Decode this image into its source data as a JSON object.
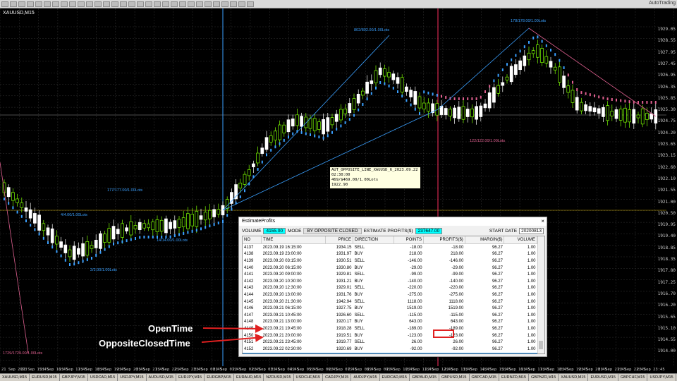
{
  "app": {
    "brand": "AutoTrading",
    "symbol": "XAUUSD,M15"
  },
  "colors": {
    "up": "#7cfc00",
    "down": "#ffffff",
    "dotUp": "#3aa0ff",
    "dotDown": "#e06090",
    "grid": "#333333",
    "cursor": "#3aa0ff",
    "marker": "#ff3060"
  },
  "price_axis": [
    "1929.05",
    "1928.55",
    "1927.95",
    "1927.45",
    "1926.95",
    "1926.35",
    "1925.85",
    "1925.30",
    "1924.75",
    "1924.20",
    "1923.65",
    "1923.15",
    "1922.60",
    "1922.10",
    "1921.55",
    "1921.00",
    "1920.50",
    "1919.95",
    "1919.40",
    "1918.85",
    "1918.35",
    "1917.80",
    "1917.25",
    "1916.70",
    "1916.20",
    "1915.65",
    "1915.10",
    "1914.55",
    "1914.00"
  ],
  "time_axis": [
    "21 Sep 2023",
    "21 Sep 15:45",
    "21 Sep 16:45",
    "21 Sep 17:45",
    "21 Sep 18:45",
    "21 Sep 19:45",
    "21 Sep 20:45",
    "21 Sep 21:45",
    "21 Sep 22:45",
    "21 Sep 23:45",
    "22 Sep 00:45",
    "22 Sep 01:45",
    "22 Sep 02:45",
    "22 Sep 03:45",
    "22 Sep 04:45",
    "22 Sep 05:45",
    "22 Sep 06:45",
    "22 Sep 07:45",
    "22 Sep 08:45",
    "22 Sep 09:45",
    "22 Sep 10:45",
    "22 Sep 11:45",
    "22 Sep 12:45",
    "22 Sep 13:45",
    "22 Sep 14:45",
    "22 Sep 15:45",
    "22 Sep 16:45",
    "22 Sep 17:45",
    "22 Sep 18:45",
    "22 Sep 19:45",
    "22 Sep 20:45",
    "22 Sep 21:45",
    "22 Sep 22:45",
    "22 Sep 23:45"
  ],
  "chart_notes": [
    "1729/1729.00/1.00Lots",
    "4/4.00/1.00Lots",
    "177/177.00/1.00Lots",
    "2/2.00/1.00Lots",
    "14/14.00/1.00Lots",
    "802/802.00/1.00Lots",
    "178/178.00/1.00Lots",
    "122/122.00/1.00Lots"
  ],
  "tooltip": [
    "AUT_OPPOSITE_LINE_XAUUSD_6_2023.09.22 02:30:00",
    "469/$469.00/1.00Lots",
    "1922.90"
  ],
  "tabs": [
    "XAUUSD,M15",
    "EURUSD,M15",
    "GBPJPY,M15",
    "USDCAD,M15",
    "USDJPY,M15",
    "AUDUSD,M15",
    "EURJPY,M15",
    "EURGBP,M15",
    "EURAUD,M15",
    "NZDUSD,M15",
    "USDCHF,M15",
    "CADJPY,M15",
    "AUDJPY,M15",
    "EURCAD,M15",
    "GBPAUD,M15",
    "GBPUSD,M15",
    "GBPCAD,M15",
    "EURNZD,M15",
    "GBPNZD,M15",
    "XAUUSD,M15",
    "EURUSD,M15",
    "GBPCHF,M15",
    "USDJPY,M15",
    "XAUUSD,Daily",
    "USDCHF,M15",
    "EURUSD,H1",
    "BTCUSD,M15",
    "XAUUSD,H1",
    "XAUUSD,H1",
    "XAUUSD,M15"
  ],
  "panel": {
    "title": "EstimateProfits",
    "volume_label": "VOLUME",
    "volume_value": "4155.00",
    "mode_label": "MODE",
    "mode_value": "BY OPPOSITE CLOSED",
    "estimate_label": "ESTIMATE PROFITS($)",
    "estimate_value": "237647.00",
    "start_date_label": "START DATE",
    "start_date_value": "20200813",
    "columns": [
      "NO",
      "TIME",
      "PRICE",
      "DIRECTION",
      "POINTS",
      "PROFITS($)",
      "MARGIN($)",
      "VOLUME"
    ],
    "rows": [
      [
        "4137",
        "2023.09.19 16:15:00",
        "1934.15",
        "SELL",
        "-18.00",
        "-18.00",
        "96.27",
        "1.00"
      ],
      [
        "4138",
        "2023.09.19 23:00:00",
        "1931.97",
        "BUY",
        "218.00",
        "218.00",
        "96.27",
        "1.00"
      ],
      [
        "4139",
        "2023.09.20 03:15:00",
        "1930.51",
        "SELL",
        "-146.00",
        "-146.00",
        "96.27",
        "1.00"
      ],
      [
        "4140",
        "2023.09.20 06:15:00",
        "1930.80",
        "BUY",
        "-29.00",
        "-29.00",
        "96.27",
        "1.00"
      ],
      [
        "4141",
        "2023.09.20 09:00:00",
        "1929.81",
        "SELL",
        "-99.00",
        "-99.00",
        "96.27",
        "1.00"
      ],
      [
        "4142",
        "2023.09.20 10:30:00",
        "1931.21",
        "BUY",
        "-140.00",
        "-140.00",
        "96.27",
        "1.00"
      ],
      [
        "4143",
        "2023.09.20 12:30:00",
        "1929.01",
        "SELL",
        "-220.00",
        "-220.00",
        "96.27",
        "1.00"
      ],
      [
        "4144",
        "2023.09.20 13:00:00",
        "1931.76",
        "BUY",
        "-275.00",
        "-275.00",
        "96.27",
        "1.00"
      ],
      [
        "4145",
        "2023.09.20 21:30:00",
        "1942.94",
        "SELL",
        "1118.00",
        "1118.00",
        "96.27",
        "1.00"
      ],
      [
        "4146",
        "2023.09.21 06:15:00",
        "1927.75",
        "BUY",
        "1519.00",
        "1519.00",
        "96.27",
        "1.00"
      ],
      [
        "4147",
        "2023.09.21 10:45:00",
        "1926.60",
        "SELL",
        "-115.00",
        "-115.00",
        "96.27",
        "1.00"
      ],
      [
        "4148",
        "2023.09.21 13:00:00",
        "1920.17",
        "BUY",
        "643.00",
        "643.00",
        "96.27",
        "1.00"
      ],
      [
        "4149",
        "2023.09.21 19:45:00",
        "1918.28",
        "SELL",
        "-189.00",
        "-189.00",
        "96.27",
        "1.00"
      ],
      [
        "4150",
        "2023.09.21 20:00:00",
        "1919.51",
        "BUY",
        "-123.00",
        "-123.00",
        "96.27",
        "1.00"
      ],
      [
        "4151",
        "2023.09.21 23:45:00",
        "1919.77",
        "SELL",
        "26.00",
        "26.00",
        "96.27",
        "1.00"
      ],
      [
        "4152",
        "2023.09.22 02:30:00",
        "1920.69",
        "BUY",
        "-92.00",
        "-92.00",
        "96.27",
        "1.00"
      ],
      [
        "4153",
        "2023.09.22 13:00:00",
        "1925.38",
        "SELL",
        "469.00",
        "469.00",
        "96.27",
        "1.00"
      ],
      [
        "4154",
        "2023.09.22 16:15:00",
        "1927.34",
        "BUY",
        "-196.00",
        "-196.00",
        "96.27",
        "1.00"
      ],
      [
        "4155",
        "2023.09.22 23:00:00",
        "1925.38",
        "SELL",
        "-197.00",
        "-197.00",
        "96.27",
        "1.00"
      ]
    ],
    "selected_row": 16
  },
  "annotations": {
    "open_time": "OpenTime",
    "opposite_closed_time": "OppositeClosedTime"
  }
}
